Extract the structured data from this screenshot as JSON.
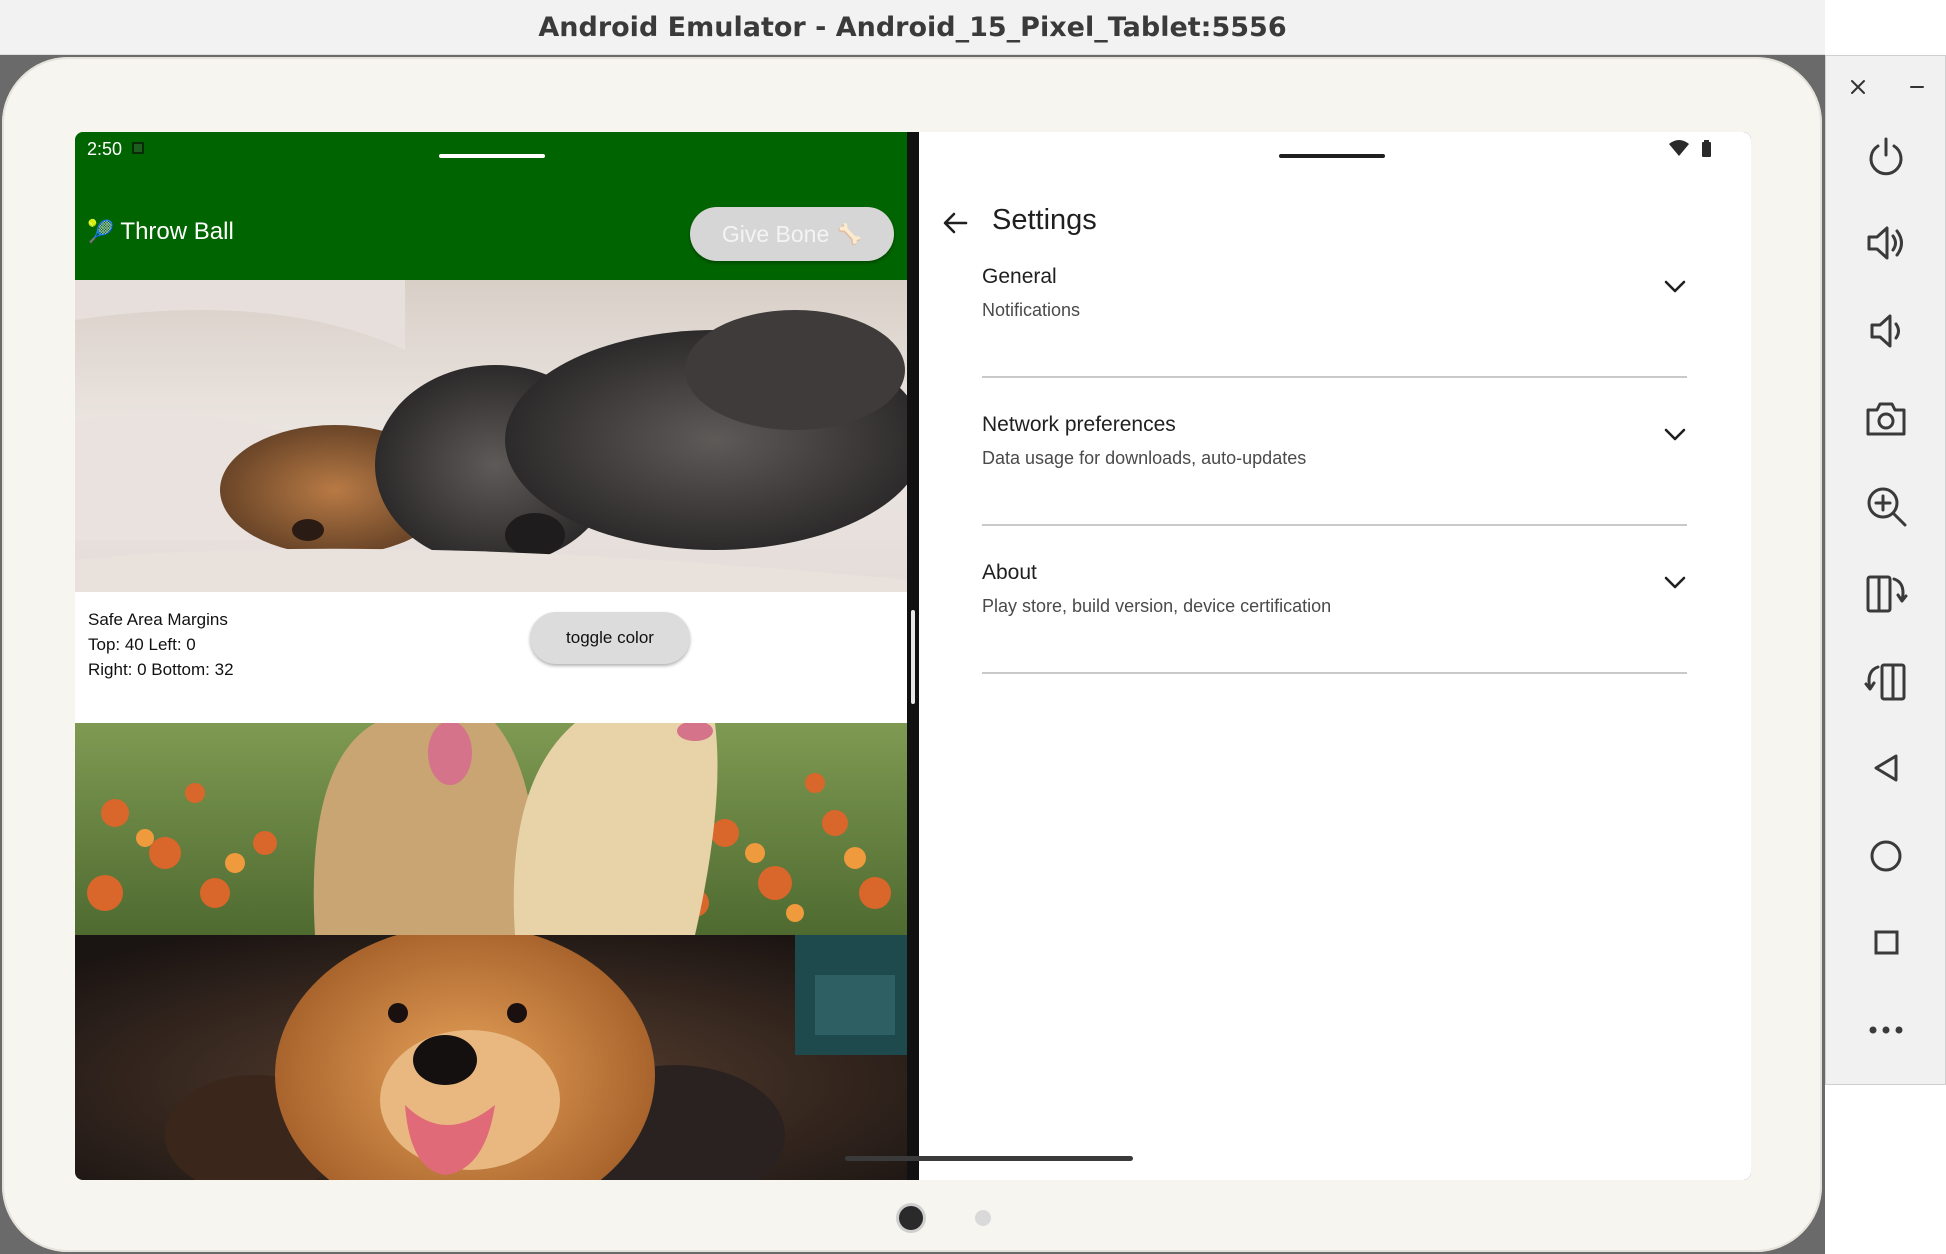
{
  "window": {
    "title": "Android Emulator - Android_15_Pixel_Tablet:5556"
  },
  "status_bar": {
    "time": "2:50",
    "wifi_icon": "wifi-icon",
    "battery_icon": "battery-icon"
  },
  "left_app": {
    "app_bar_color": "#006400",
    "throw_ball": {
      "emoji": "🎾",
      "label": "Throw Ball"
    },
    "give_bone": {
      "label": "Give Bone",
      "emoji": "🦴"
    },
    "safe_area": {
      "title": "Safe Area Margins",
      "line1": "Top: 40 Left: 0",
      "line2": "Right: 0 Bottom: 32"
    },
    "toggle_color": "toggle color",
    "photos": [
      "sleeping-dogs-photo",
      "puppies-in-flowers-photo",
      "golden-retriever-photo"
    ]
  },
  "settings": {
    "title": "Settings",
    "items": [
      {
        "title": "General",
        "subtitle": "Notifications"
      },
      {
        "title": "Network preferences",
        "subtitle": "Data usage for downloads, auto-updates"
      },
      {
        "title": "About",
        "subtitle": "Play store, build version, device certification"
      }
    ]
  },
  "emulator_toolbar": {
    "close": "close-icon",
    "minimize": "minimize-icon",
    "buttons": [
      "power-icon",
      "volume-up-icon",
      "volume-down-icon",
      "camera-icon",
      "zoom-icon",
      "rotate-left-icon",
      "rotate-right-icon",
      "back-icon",
      "home-icon",
      "overview-icon",
      "more-icon"
    ]
  }
}
